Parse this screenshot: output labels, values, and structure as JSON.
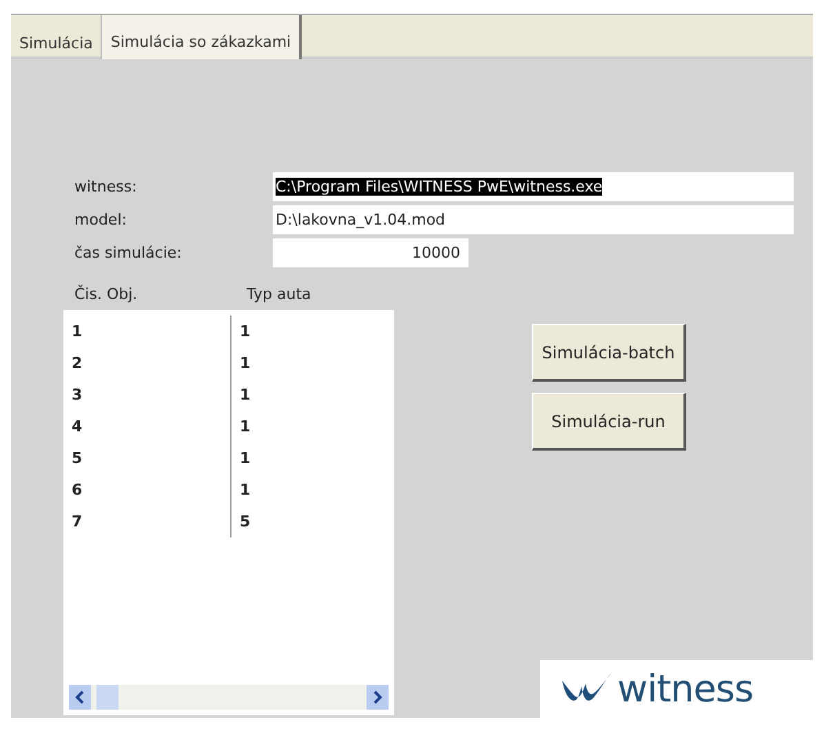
{
  "tabs": [
    {
      "label": "Simulácia",
      "selected": false
    },
    {
      "label": "Simulácia so zákazkami",
      "selected": true
    }
  ],
  "fields": [
    {
      "label": "witness:",
      "value": "C:\\Program Files\\WITNESS PwE\\witness.exe",
      "text_selected": true,
      "kind": "wide"
    },
    {
      "label": "model:",
      "value": "D:\\lakovna_v1.04.mod",
      "text_selected": false,
      "kind": "wide"
    },
    {
      "label": "čas simulácie:",
      "value": "10000",
      "text_selected": false,
      "kind": "number"
    }
  ],
  "list": {
    "columns": [
      "Čis. Obj.",
      "Typ auta"
    ],
    "rows": [
      [
        "1",
        "1"
      ],
      [
        "2",
        "1"
      ],
      [
        "3",
        "1"
      ],
      [
        "4",
        "1"
      ],
      [
        "5",
        "1"
      ],
      [
        "6",
        "1"
      ],
      [
        "7",
        "5"
      ]
    ]
  },
  "buttons": [
    "Simulácia-batch",
    "Simulácia-run"
  ],
  "logo": {
    "text": "witness"
  }
}
